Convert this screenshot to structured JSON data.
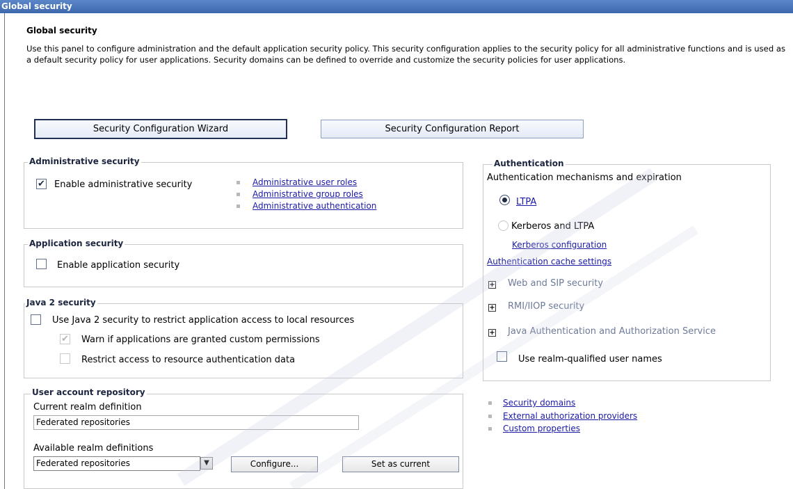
{
  "window": {
    "title": "Global security"
  },
  "page": {
    "heading": "Global security",
    "intro": "Use this panel to configure administration and the default application security policy. This security configuration applies to the security policy for all administrative functions and is used as a default security policy for user applications. Security domains can be defined to override and customize the security policies for user applications."
  },
  "buttons": {
    "wizard": "Security Configuration Wizard",
    "report": "Security Configuration Report"
  },
  "admin_security": {
    "legend": "Administrative security",
    "enable_label": "Enable administrative security",
    "enable_checked": true,
    "links": [
      "Administrative user roles",
      "Administrative group roles",
      "Administrative authentication"
    ]
  },
  "app_security": {
    "legend": "Application security",
    "enable_label": "Enable application security",
    "enable_checked": false
  },
  "java2_security": {
    "legend": "Java 2 security",
    "use_label": "Use Java 2 security to restrict application access to local resources",
    "use_checked": false,
    "warn_label": "Warn if applications are granted custom permissions",
    "warn_checked": true,
    "restrict_label": "Restrict access to resource authentication data",
    "restrict_checked": false
  },
  "user_repo": {
    "legend": "User account repository",
    "current_label": "Current realm definition",
    "current_value": "Federated repositories",
    "available_label": "Available realm definitions",
    "available_selected": "Federated repositories",
    "configure_label": "Configure...",
    "set_current_label": "Set as current"
  },
  "authentication": {
    "legend": "Authentication",
    "mechanisms_label": "Authentication mechanisms and expiration",
    "ltpa_label": "LTPA",
    "ltpa_selected": true,
    "kerberos_label": "Kerberos and LTPA",
    "kerberos_config_link": "Kerberos configuration",
    "cache_settings_link": "Authentication cache settings",
    "expandables": [
      "Web and SIP security",
      "RMI/IIOP security",
      "Java Authentication and Authorization Service"
    ],
    "realm_qualified_label": "Use realm-qualified user names",
    "realm_qualified_checked": false
  },
  "related_links": [
    "Security domains",
    "External authorization providers",
    "Custom properties"
  ],
  "colors": {
    "titlebar": "#3e68ad",
    "link": "#1a1aa6",
    "border": "#c9c9c9"
  }
}
